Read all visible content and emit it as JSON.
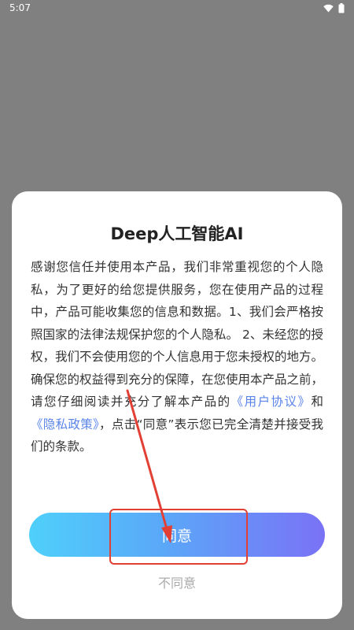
{
  "status_bar": {
    "time": "5:07",
    "icons": [
      "wifi-icon",
      "battery-icon"
    ]
  },
  "dialog": {
    "title": "Deep人工智能AI",
    "body": {
      "text_before_user_agreement": "感谢您信任并使用本产品，我们非常重视您的个人隐私，为了更好的给您提供服务，您在使用产品的过程中，产品可能收集您的信息和数据。1、我们会严格按照国家的法律法规保护您的个人隐私。 2、未经您的授权，我们不会使用您的个人信息用于您未授权的地方。 确保您的权益得到充分的保障，在您使用本产品之前，请您仔细阅读并充分了解本产品的",
      "user_agreement_link": "《用户协议》",
      "conjunction": "和",
      "privacy_policy_link": "《隐私政策》",
      "text_after_links": "，点击“同意”表示您已完全清楚并接受我们的条款。"
    },
    "agree_label": "同意",
    "disagree_label": "不同意"
  },
  "colors": {
    "link": "#5a84e8",
    "annotation": "#e24034",
    "gradient_start": "#4fd0fb",
    "gradient_end": "#7a72f6"
  }
}
